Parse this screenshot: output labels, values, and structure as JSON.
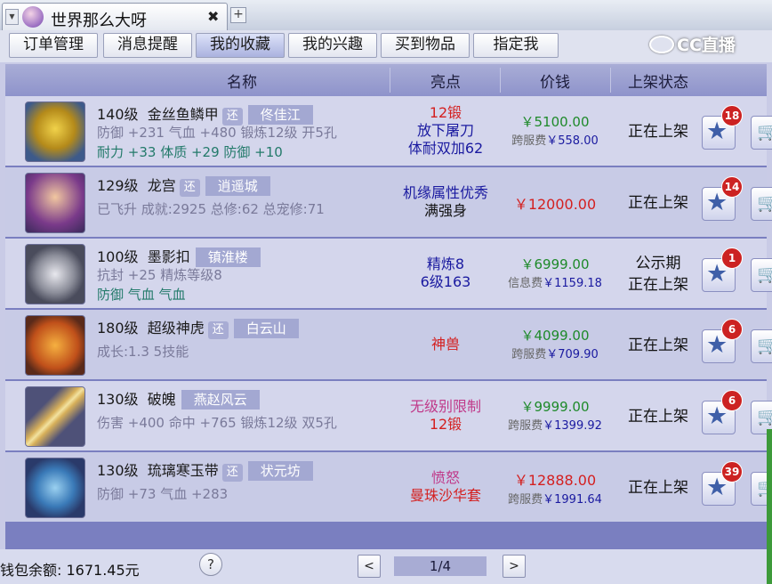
{
  "window": {
    "title": "世界那么大呀",
    "close": "✖",
    "new_tab": "+"
  },
  "watermark": "CC直播",
  "nav_tabs": [
    {
      "label": "订单管理"
    },
    {
      "label": "消息提醒"
    },
    {
      "label": "我的收藏",
      "active": true
    },
    {
      "label": "我的兴趣"
    },
    {
      "label": "买到物品"
    },
    {
      "label": "指定我"
    }
  ],
  "columns": {
    "name": "名称",
    "highlight": "亮点",
    "price": "价钱",
    "status": "上架状态"
  },
  "colors": {
    "board": "#7a7fc0",
    "price_green": "#1e8a2a",
    "price_red": "#d42020",
    "attr_teal": "#237a6a"
  },
  "items": [
    {
      "level": "140级",
      "name": "金丝鱼鳞甲",
      "badge": "还",
      "server": "佟佳江",
      "line2": "防御 +231 气血 +480 锻炼12级 开5孔",
      "line3": "耐力 +33 体质 +29 防御 +10",
      "highlights": [
        {
          "text": "12锻",
          "color": "#d42020"
        },
        {
          "text": "放下屠刀",
          "color": "#1a1aa0"
        },
        {
          "text": "体耐双加62",
          "color": "#1a1aa0"
        }
      ],
      "price": "￥5100.00",
      "price_color": "green",
      "fee_label": "跨服费",
      "fee": "￥558.00",
      "status": [
        "正在上架"
      ],
      "fav_count": "18",
      "icon": "armor-icon"
    },
    {
      "level": "129级",
      "name": "龙宫",
      "badge": "还",
      "server": "逍遥城",
      "line2": "已飞升 成就:2925 总修:62 总宠修:71",
      "line3": "",
      "highlights": [
        {
          "text": "机缘属性优秀",
          "color": "#1a1aa0"
        },
        {
          "text": "满强身",
          "color": "#111"
        }
      ],
      "price": "￥12000.00",
      "price_color": "red",
      "fee_label": "",
      "fee": "",
      "status": [
        "正在上架"
      ],
      "fav_count": "14",
      "icon": "character-icon"
    },
    {
      "level": "100级",
      "name": "墨影扣",
      "badge": "",
      "server": "镇淮楼",
      "line2": "抗封 +25 精炼等级8",
      "line3": "防御 气血 气血",
      "highlights": [
        {
          "text": "精炼8",
          "color": "#1a1aa0"
        },
        {
          "text": "6级163",
          "color": "#1a1aa0"
        }
      ],
      "price": "￥6999.00",
      "price_color": "green",
      "fee_label": "信息费",
      "fee": "￥1159.18",
      "status": [
        "公示期",
        "正在上架"
      ],
      "fav_count": "1",
      "icon": "ring-icon"
    },
    {
      "level": "180级",
      "name": "超级神虎",
      "badge": "还",
      "server": "白云山",
      "line2": "成长:1.3 5技能",
      "line3": "",
      "highlights": [
        {
          "text": "神兽",
          "color": "#d42020"
        }
      ],
      "price": "￥4099.00",
      "price_color": "green",
      "fee_label": "跨服费",
      "fee": "￥709.90",
      "status": [
        "正在上架"
      ],
      "fav_count": "6",
      "icon": "tiger-icon"
    },
    {
      "level": "130级",
      "name": "破魄",
      "badge": "",
      "server": "燕赵风云",
      "line2": "伤害 +400 命中 +765 锻炼12级 双5孔",
      "line3": "",
      "highlights": [
        {
          "text": "无级别限制",
          "color": "#c03a8a"
        },
        {
          "text": "12锻",
          "color": "#d42020"
        }
      ],
      "price": "￥9999.00",
      "price_color": "green",
      "fee_label": "跨服费",
      "fee": "￥1399.92",
      "status": [
        "正在上架"
      ],
      "fav_count": "6",
      "icon": "weapon-icon"
    },
    {
      "level": "130级",
      "name": "琉璃寒玉带",
      "badge": "还",
      "server": "状元坊",
      "line2": "防御 +73 气血 +283",
      "line3": "",
      "highlights": [
        {
          "text": "愤怒",
          "color": "#c03a8a"
        },
        {
          "text": "曼珠沙华套",
          "color": "#d42020"
        }
      ],
      "price": "￥12888.00",
      "price_color": "red",
      "fee_label": "跨服费",
      "fee": "￥1991.64",
      "status": [
        "正在上架"
      ],
      "fav_count": "39",
      "icon": "belt-icon"
    }
  ],
  "footer": {
    "wallet": "钱包余额: 1671.45元",
    "help": "?",
    "prev": "<",
    "page": "1/4",
    "next": ">"
  }
}
